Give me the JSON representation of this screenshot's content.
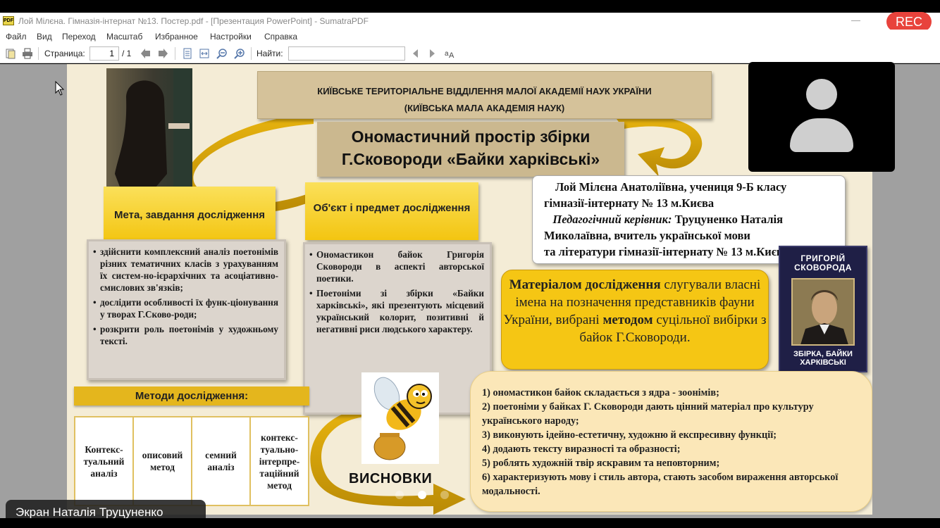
{
  "window": {
    "title": "Лой Мілєна. Гімназія-інтернат №13. Постер.pdf - [Презентация PowerPoint] - SumatraPDF",
    "rec_label": "REC"
  },
  "menu": [
    "Файл",
    "Вид",
    "Переход",
    "Масштаб",
    "Избранное",
    "Настройки",
    "Справка"
  ],
  "toolbar": {
    "page_label": "Страница:",
    "page_value": "1",
    "page_total": "/ 1",
    "find_label": "Найти:",
    "find_value": ""
  },
  "slide": {
    "header_line1": "КИЇВСЬКЕ ТЕРИТОРІАЛЬНЕ ВІДДІЛЕННЯ МАЛОЇ АКАДЕМІЇ НАУК УКРАЇНИ",
    "header_line2": "(КИЇВСЬКА МАЛА АКАДЕМІЯ НАУК)",
    "title_line1": "Ономастичний простір збірки",
    "title_line2": "Г.Сковороди «Байки харківські»",
    "author_line1": "Лой Мілєна Анатоліївна, учениця 9-Б класу",
    "author_line2": "гімназії-інтернату № 13 м.Києва",
    "author_supervisor_label": "Педагогічний керівник:",
    "author_supervisor_name": "Труцуненко Наталія",
    "author_line4": "Миколаївна, вчитель української мови",
    "author_line5": "та літератури гімназії-інтернату № 13 м.Києва",
    "goal_head": "Мета, завдання дослідження",
    "goal_items": [
      "здійснити комплексний аналіз поетонімів різних тематичних класів з урахуванням їх систем-но-ієрархічних та асоціативно-смислових зв'язків;",
      "дослідити особливості їх функ-ціонування у творах Г.Сково-роди;",
      "розкрити роль поетонімів у художньому тексті."
    ],
    "object_head": "Об'єкт і предмет дослідження",
    "object_items": [
      "Ономастикон байок Григорія Сковороди в аспекті авторської поетики.",
      "Поетоніми зі збірки «Байки харківські», які презентують місцевий український колорит, позитивні й негативні риси людського характеру."
    ],
    "methods_head": "Методи дослідження:",
    "methods": [
      "Контекс-туальний аналіз",
      "описовий метод",
      "семний аналіз",
      "контекс-туально-інтерпре-таційний метод"
    ],
    "material_bold1": "Матеріалом дослідження",
    "material_text1": " слугували власні імена на позначення представників фауни України, вибрані ",
    "material_bold2": "методом",
    "material_text2": " суцільної вибірки з байок Г.Сковороди.",
    "book_title": "ГРИГОРІЙ СКОВОРОДА",
    "book_bottom": "ЗБІРКА, БАЙКИ ХАРКІВСЬКІ",
    "conclusions_label": "ВИСНОВКИ",
    "conclusions": [
      "1) ономастикон байок складається з ядра - зоонімів;",
      "2) поетоніми у байках Г. Сковороди дають цінний матеріал про культуру українського народу;",
      "3) виконують ідейно-естетичну, художню й експресивну функції;",
      "4) додають тексту виразності та образності;",
      "5) роблять художній твір яскравим та неповторним;",
      "6) характеризують мову і стиль автора, стають засобом вираження авторської модальності."
    ]
  },
  "overlay": {
    "screen_label": "Экран Наталія Труцуненко"
  },
  "icons": [
    "open-icon",
    "print-icon",
    "prev-page-icon",
    "next-page-icon",
    "fit-page-icon",
    "fit-width-icon",
    "zoom-out-icon",
    "zoom-in-icon",
    "find-prev-icon",
    "find-next-icon",
    "match-case-icon",
    "user-avatar-icon",
    "cursor-icon"
  ]
}
